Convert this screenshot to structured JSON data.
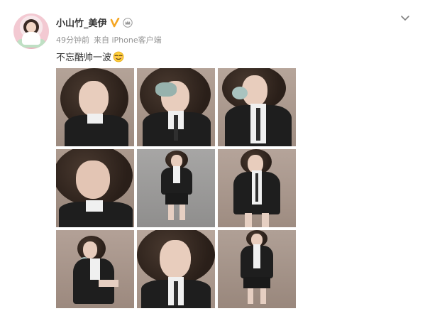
{
  "post": {
    "username": "小山竹_美伊",
    "verified_icon": "verified-v-icon",
    "member_icon": "crown-icon",
    "time": "49分钟前",
    "source": "来自 iPhone客户端",
    "text": "不忘酷帅一波",
    "emoji": "cool-face-emoji"
  },
  "icons": {
    "menu": "chevron-down-icon"
  },
  "colors": {
    "verified": "#f5a623",
    "username": "#333333",
    "meta": "#939393",
    "photo_backdrop": "#a8958a"
  },
  "photos": [
    {
      "label": "photo-1"
    },
    {
      "label": "photo-2"
    },
    {
      "label": "photo-3"
    },
    {
      "label": "photo-4"
    },
    {
      "label": "photo-5"
    },
    {
      "label": "photo-6"
    },
    {
      "label": "photo-7"
    },
    {
      "label": "photo-8"
    },
    {
      "label": "photo-9"
    }
  ]
}
